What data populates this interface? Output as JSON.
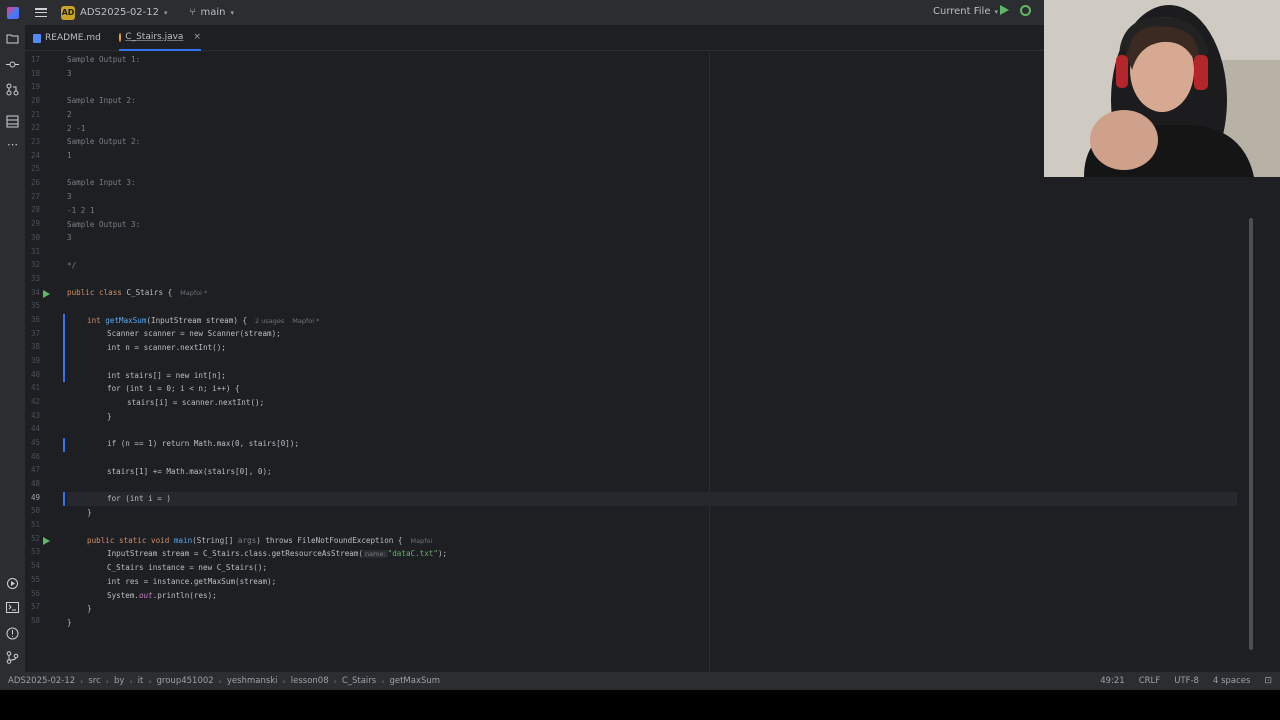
{
  "titlebar": {
    "project_badge": "AD",
    "project_name": "ADS2025-02-12",
    "branch": "main",
    "run_config": "Current File"
  },
  "tabs": [
    {
      "label": "README.md",
      "active": false
    },
    {
      "label": "C_Stairs.java",
      "active": true
    }
  ],
  "editor": {
    "line_numbers": [
      "17",
      "18",
      "19",
      "20",
      "21",
      "22",
      "23",
      "24",
      "25",
      "26",
      "27",
      "28",
      "29",
      "30",
      "31",
      "32",
      "33",
      "34",
      "35",
      "36",
      "37",
      "38",
      "39",
      "40",
      "41",
      "42",
      "43",
      "44",
      "45",
      "46",
      "47",
      "48",
      "49",
      "50",
      "51",
      "52",
      "53",
      "54",
      "55",
      "56",
      "57",
      "58"
    ],
    "current_line": "49",
    "code": {
      "l17": "Sample Output 1:",
      "l18": "3",
      "l20": "Sample Input 2:",
      "l21": "2",
      "l22": "2 -1",
      "l23": "Sample Output 2:",
      "l24": "1",
      "l26": "Sample Input 3:",
      "l27": "3",
      "l28": "-1 2 1",
      "l29": "Sample Output 3:",
      "l30": "3",
      "l32": "*/",
      "l34_kw": "public class ",
      "l34_name": "C_Stairs {",
      "l34_hint": "Mapfoi *",
      "l36_kw": "int ",
      "l36_fn": "getMaxSum",
      "l36_rest": "(InputStream stream) {",
      "l36_hint": "2 usages",
      "l36_hint2": "Mapfoi *",
      "l37": "Scanner scanner = new Scanner(stream);",
      "l38": "int n = scanner.nextInt();",
      "l40": "int stairs[] = new int[n];",
      "l41": "for (int i = 0; i < n; i++) {",
      "l42": "stairs[i] = scanner.nextInt();",
      "l43": "}",
      "l45": "if (n == 1) return Math.max(0, stairs[0]);",
      "l47": "stairs[1] += Math.max(stairs[0], 0);",
      "l49": "for (int i = )",
      "l50": "}",
      "l52_a": "public static void ",
      "l52_fn": "main",
      "l52_b": "(String[] ",
      "l52_param": "args",
      "l52_c": ") throws FileNotFoundException {",
      "l52_hint": "Mapfoi",
      "l53_a": "InputStream stream = C_Stairs.class.getResourceAsStream(",
      "l53_hint": "name:",
      "l53_str": "\"dataC.txt\"",
      "l53_b": ");",
      "l54": "C_Stairs instance = new C_Stairs();",
      "l55": "int res = instance.getMaxSum(stream);",
      "l56_a": "System.",
      "l56_field": "out",
      "l56_b": ".println(res);",
      "l57": "}",
      "l58": "}"
    }
  },
  "statusbar": {
    "breadcrumbs": [
      "ADS2025-02-12",
      "src",
      "by",
      "it",
      "group451002",
      "yeshmanski",
      "lesson08",
      "C_Stairs",
      "getMaxSum"
    ],
    "position": "49:21",
    "line_ending": "CRLF",
    "encoding": "UTF-8",
    "indent": "4 spaces"
  },
  "colors": {
    "accent": "#3574f0",
    "run_green": "#5fb865",
    "keyword": "#cf8e6d",
    "function": "#56a8f5",
    "comment": "#7a7e85"
  }
}
